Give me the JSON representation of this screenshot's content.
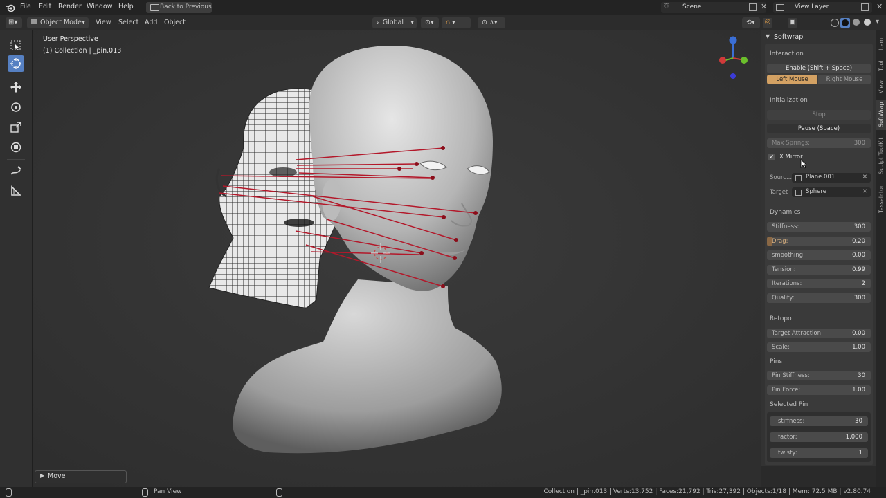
{
  "menu": {
    "items": [
      "File",
      "Edit",
      "Render",
      "Window",
      "Help"
    ],
    "back_button": "Back to Previous",
    "scene": "Scene",
    "view_layer": "View Layer"
  },
  "header": {
    "mode": "Object Mode",
    "view": "View",
    "select": "Select",
    "add": "Add",
    "object": "Object",
    "orientation": "Global"
  },
  "viewport": {
    "perspective": "User Perspective",
    "collection": "(1) Collection | _pin.013",
    "move_panel": "Move"
  },
  "npanel": {
    "title": "Softwrap",
    "interaction": {
      "heading": "Interaction",
      "enable": "Enable (Shift + Space)",
      "left": "Left Mouse",
      "right": "Right Mouse"
    },
    "initialization": {
      "heading": "Initialization",
      "stop": "Stop",
      "pause": "Pause (Space)",
      "max_springs_label": "Max Springs:",
      "max_springs_value": "300",
      "x_mirror": "X Mirror",
      "source_label": "Sourc...",
      "source_value": "Plane.001",
      "target_label": "Target",
      "target_value": "Sphere"
    },
    "dynamics": {
      "heading": "Dynamics",
      "fields": [
        {
          "label": "Stiffness:",
          "value": "300"
        },
        {
          "label": "Drag:",
          "value": "0.20"
        },
        {
          "label": "smoothing:",
          "value": "0.00"
        },
        {
          "label": "Tension:",
          "value": "0.99"
        },
        {
          "label": "Iterations:",
          "value": "2"
        },
        {
          "label": "Quality:",
          "value": "300"
        }
      ]
    },
    "retopo": {
      "heading": "Retopo",
      "fields": [
        {
          "label": "Target Attraction:",
          "value": "0.00"
        },
        {
          "label": "Scale:",
          "value": "1.00"
        }
      ]
    },
    "pins": {
      "heading": "Pins",
      "fields": [
        {
          "label": "Pin Stiffness:",
          "value": "30"
        },
        {
          "label": "Pin Force:",
          "value": "1.00"
        }
      ]
    },
    "selected_pin": {
      "heading": "Selected Pin",
      "fields": [
        {
          "label": "stiffness:",
          "value": "30"
        },
        {
          "label": "factor:",
          "value": "1.000"
        },
        {
          "label": "twisty:",
          "value": "1"
        }
      ]
    },
    "tabs": [
      "Item",
      "Tool",
      "View",
      "SoftWrap",
      "Sculpt ToolKit",
      "Tesselator"
    ]
  },
  "status": {
    "pan_view": "Pan View",
    "info": "Collection | _pin.013 | Verts:13,752 | Faces:21,792 | Tris:27,392 | Objects:1/18 | Mem: 72.5 MB | v2.80.74"
  },
  "colors": {
    "accent": "#5680c2",
    "pin_line": "#b3182a",
    "active_button": "#d3a163"
  }
}
